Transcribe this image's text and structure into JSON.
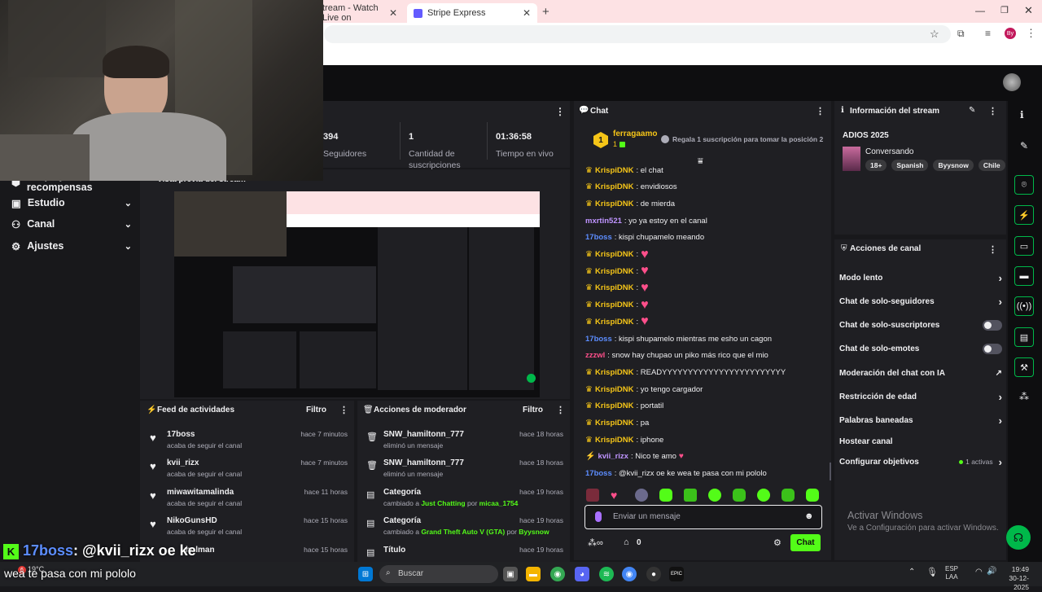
{
  "browser": {
    "tab1_title": "tream - Watch Live on",
    "tab2_title": "Stripe Express",
    "profile_initials": "By"
  },
  "sidebar": {
    "items": [
      {
        "label": "Drops y recompensas"
      },
      {
        "label": "Estudio"
      },
      {
        "label": "Canal"
      },
      {
        "label": "Ajustes"
      }
    ]
  },
  "stats": {
    "followers_value": "394",
    "followers_label": "Seguidores",
    "subs_value": "1",
    "subs_label": "Cantidad de suscripciones",
    "live_value": "01:36:58",
    "live_label": "Tiempo en vivo"
  },
  "preview": {
    "title": "Vista previa del stream"
  },
  "activity_feed": {
    "title": "Feed de actividades",
    "filter": "Filtro",
    "items": [
      {
        "name": "17boss",
        "sub": "acaba de seguir el canal",
        "time": "hace 7 minutos"
      },
      {
        "name": "kvii_rizx",
        "sub": "acaba de seguir el canal",
        "time": "hace 7 minutos"
      },
      {
        "name": "miwawitamalinda",
        "sub": "acaba de seguir el canal",
        "time": "hace 11 horas"
      },
      {
        "name": "NikoGunsHD",
        "sub": "acaba de seguir el canal",
        "time": "hace 15 horas"
      },
      {
        "name": "holman",
        "sub": "",
        "time": "hace 15 horas"
      }
    ]
  },
  "mod_actions": {
    "title": "Acciones de moderador",
    "filter": "Filtro",
    "items": [
      {
        "name": "SNW_hamiltonn_777",
        "sub": "eliminó un mensaje",
        "time": "hace 18 horas"
      },
      {
        "name": "SNW_hamiltonn_777",
        "sub": "eliminó un mensaje",
        "time": "hace 18 horas"
      },
      {
        "name": "Categoría",
        "sub_prefix": "cambiado a ",
        "sub_hl": "Just Chatting",
        "sub_by": " por ",
        "sub_user": "micaa_1754",
        "time": "hace 19 horas"
      },
      {
        "name": "Categoría",
        "sub_prefix": "cambiado a ",
        "sub_hl": "Grand Theft Auto V (GTA)",
        "sub_by": " por ",
        "sub_user": "Byysnow",
        "time": "hace 19 horas"
      },
      {
        "name": "Título",
        "time": "hace 19 horas"
      }
    ]
  },
  "chat": {
    "title": "Chat",
    "top_user": "ferragaamo",
    "top_rank": "1",
    "top_count": "1",
    "gift_prompt": "Regala 1 suscripción para tomar la posición 2",
    "messages": [
      {
        "user": "KrispiDNK",
        "text": ": el chat",
        "color": "#f5c518",
        "crown": true
      },
      {
        "user": "KrispiDNK",
        "text": ": envidiosos",
        "color": "#f5c518",
        "crown": true
      },
      {
        "user": "KrispiDNK",
        "text": ": de mierda",
        "color": "#f5c518",
        "crown": true
      },
      {
        "user": "mxrtin521",
        "text": ": yo ya estoy en el canal",
        "color": "#bf94ff",
        "crown": false
      },
      {
        "user": "17boss",
        "text": ": kispi chupamelo meando",
        "color": "#5c8dff",
        "crown": false
      },
      {
        "user": "KrispiDNK",
        "text": ":",
        "color": "#f5c518",
        "crown": true,
        "emote": true
      },
      {
        "user": "KrispiDNK",
        "text": ":",
        "color": "#f5c518",
        "crown": true,
        "emote": true
      },
      {
        "user": "KrispiDNK",
        "text": ":",
        "color": "#f5c518",
        "crown": true,
        "emote": true
      },
      {
        "user": "KrispiDNK",
        "text": ":",
        "color": "#f5c518",
        "crown": true,
        "emote": true
      },
      {
        "user": "KrispiDNK",
        "text": ":",
        "color": "#f5c518",
        "crown": true,
        "emote": true
      },
      {
        "user": "17boss",
        "text": ": kispi shupamelo mientras me esho un cagon",
        "color": "#5c8dff",
        "crown": false
      },
      {
        "user": "zzzwl",
        "text": ": snow hay chupao un piko más rico que el mio",
        "color": "#ff4f8b",
        "crown": false
      },
      {
        "user": "KrispiDNK",
        "text": ": READYYYYYYYYYYYYYYYYYYYYYYYY",
        "color": "#f5c518",
        "crown": true
      },
      {
        "user": "KrispiDNK",
        "text": ": yo tengo cargador",
        "color": "#f5c518",
        "crown": true
      },
      {
        "user": "KrispiDNK",
        "text": ": portatil",
        "color": "#f5c518",
        "crown": true
      },
      {
        "user": "KrispiDNK",
        "text": ": pa",
        "color": "#f5c518",
        "crown": true
      },
      {
        "user": "KrispiDNK",
        "text": ": iphone",
        "color": "#f5c518",
        "crown": true
      },
      {
        "user": "kvii_rizx",
        "text": ": Nico te amo",
        "color": "#bf94ff",
        "crown": false
      },
      {
        "user": "17boss",
        "text": ": @kvii_rizx oe ke wea te pasa con mi pololo",
        "color": "#5c8dff",
        "crown": false
      }
    ],
    "input_placeholder": "Enviar un mensaje",
    "points": "0",
    "send_label": "Chat"
  },
  "stream_info": {
    "title": "Información del stream",
    "stream_title": "ADIOS 2025",
    "category": "Conversando",
    "tags": [
      "18+",
      "Spanish",
      "Byysnow",
      "Chile"
    ]
  },
  "channel_actions": {
    "title": "Acciones de canal",
    "items": [
      {
        "label": "Modo lento",
        "control": "chevron"
      },
      {
        "label": "Chat de solo-seguidores",
        "control": "chevron"
      },
      {
        "label": "Chat de solo-suscriptores",
        "control": "toggle"
      },
      {
        "label": "Chat de solo-emotes",
        "control": "toggle"
      },
      {
        "label": "Moderación del chat con IA",
        "control": "external"
      },
      {
        "label": "Restricción de edad",
        "control": "chevron"
      },
      {
        "label": "Palabras baneadas",
        "control": "chevron"
      },
      {
        "label": "Hostear canal",
        "control": "none"
      },
      {
        "label": "Configurar objetivos",
        "control": "chevron",
        "badge": "1 activas"
      }
    ]
  },
  "watermark": {
    "line1": "Activar Windows",
    "line2": "Ve a Configuración para activar Windows."
  },
  "overlay": {
    "user": "17boss",
    "text": ": @kvii_rizx oe ke",
    "line2": "wea te pasa con mi pololo"
  },
  "taskbar": {
    "search_placeholder": "Buscar",
    "temperature": "19°C",
    "lang1": "ESP",
    "lang2": "LAA",
    "time": "19:49",
    "date": "30-12-2025",
    "notif_count": "6"
  }
}
